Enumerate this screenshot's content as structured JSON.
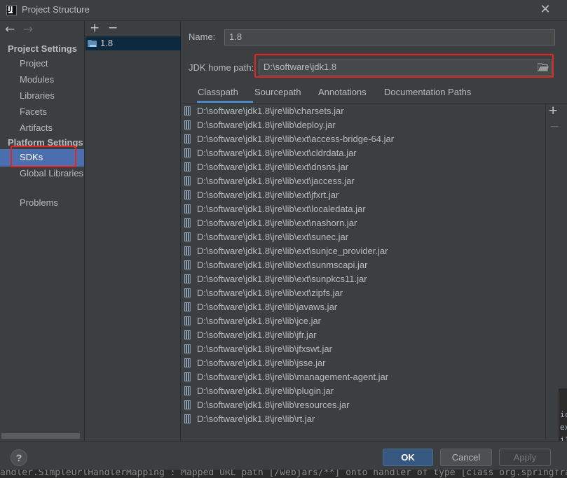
{
  "window": {
    "title": "Project Structure"
  },
  "sidebar": {
    "project_settings_header": "Project Settings",
    "project_items": [
      "Project",
      "Modules",
      "Libraries",
      "Facets",
      "Artifacts"
    ],
    "platform_settings_header": "Platform Settings",
    "platform_items": [
      "SDKs",
      "Global Libraries"
    ],
    "selected_item": "SDKs",
    "problems": "Problems"
  },
  "sdk_list": {
    "add_label": "+",
    "remove_label": "−",
    "items": [
      "1.8"
    ]
  },
  "detail": {
    "name_label": "Name:",
    "name_value": "1.8",
    "jdk_home_label": "JDK home path:",
    "jdk_home_value": "D:\\software\\jdk1.8",
    "tabs": [
      "Classpath",
      "Sourcepath",
      "Annotations",
      "Documentation Paths"
    ],
    "active_tab": "Classpath",
    "classpath": [
      "D:\\software\\jdk1.8\\jre\\lib\\charsets.jar",
      "D:\\software\\jdk1.8\\jre\\lib\\deploy.jar",
      "D:\\software\\jdk1.8\\jre\\lib\\ext\\access-bridge-64.jar",
      "D:\\software\\jdk1.8\\jre\\lib\\ext\\cldrdata.jar",
      "D:\\software\\jdk1.8\\jre\\lib\\ext\\dnsns.jar",
      "D:\\software\\jdk1.8\\jre\\lib\\ext\\jaccess.jar",
      "D:\\software\\jdk1.8\\jre\\lib\\ext\\jfxrt.jar",
      "D:\\software\\jdk1.8\\jre\\lib\\ext\\localedata.jar",
      "D:\\software\\jdk1.8\\jre\\lib\\ext\\nashorn.jar",
      "D:\\software\\jdk1.8\\jre\\lib\\ext\\sunec.jar",
      "D:\\software\\jdk1.8\\jre\\lib\\ext\\sunjce_provider.jar",
      "D:\\software\\jdk1.8\\jre\\lib\\ext\\sunmscapi.jar",
      "D:\\software\\jdk1.8\\jre\\lib\\ext\\sunpkcs11.jar",
      "D:\\software\\jdk1.8\\jre\\lib\\ext\\zipfs.jar",
      "D:\\software\\jdk1.8\\jre\\lib\\javaws.jar",
      "D:\\software\\jdk1.8\\jre\\lib\\jce.jar",
      "D:\\software\\jdk1.8\\jre\\lib\\jfr.jar",
      "D:\\software\\jdk1.8\\jre\\lib\\jfxswt.jar",
      "D:\\software\\jdk1.8\\jre\\lib\\jsse.jar",
      "D:\\software\\jdk1.8\\jre\\lib\\management-agent.jar",
      "D:\\software\\jdk1.8\\jre\\lib\\plugin.jar",
      "D:\\software\\jdk1.8\\jre\\lib\\resources.jar",
      "D:\\software\\jdk1.8\\jre\\lib\\rt.jar"
    ]
  },
  "buttons": {
    "help": "?",
    "ok": "OK",
    "cancel": "Cancel",
    "apply": "Apply"
  },
  "background": {
    "log_line": "andler.SimpleUrlHandlerMapping  : Mapped URL path [/webjars/**] onto handler of type [class org.springframework.web",
    "right_edge_fragments": [
      "ic",
      "ex",
      "i1",
      "yi"
    ]
  },
  "colors": {
    "dialog_bg": "#3c3f41",
    "selection": "#4b6eaf",
    "highlight_box": "#e5261f",
    "ok_button": "#365880",
    "tab_underline": "#4a88c7"
  }
}
